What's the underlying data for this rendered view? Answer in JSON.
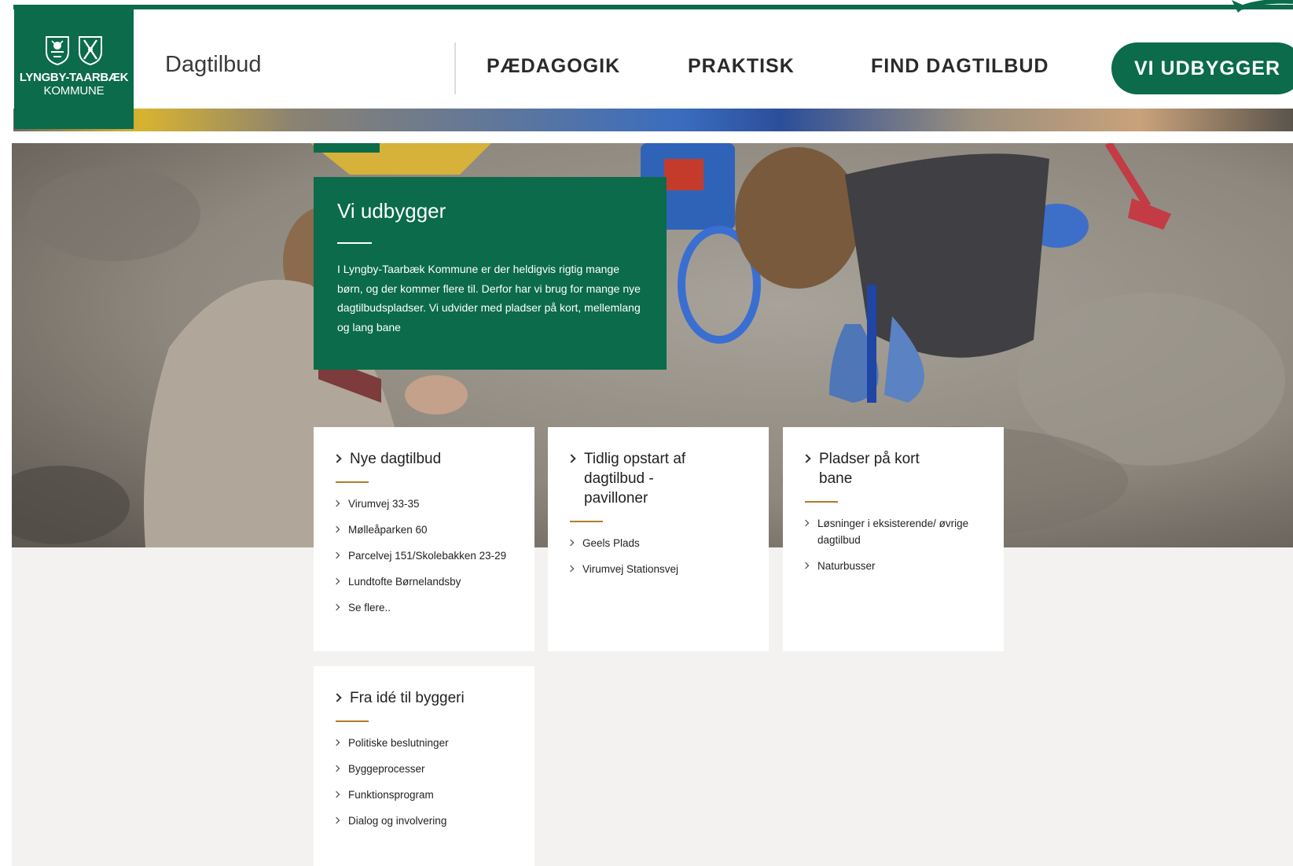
{
  "brand": {
    "logo_line1": "LYNGBY-TAARBÆK",
    "logo_line2": "KOMMUNE",
    "site_title": "Dagtilbud"
  },
  "nav": {
    "items": [
      "PÆDAGOGIK",
      "PRAKTISK",
      "FIND DAGTILBUD"
    ],
    "cta": "VI UDBYGGER"
  },
  "hero": {
    "title": "Vi udbygger",
    "text": "I Lyngby-Taarbæk Kommune er der heldigvis rigtig mange børn, og der kommer flere til. Derfor har vi brug for mange nye dagtilbudspladser. Vi udvider med pladser på kort, mellemlang og lang bane"
  },
  "cards": [
    {
      "title": "Nye dagtilbud",
      "links": [
        "Virumvej 33-35",
        "Mølleåparken 60",
        "Parcelvej 151/Skolebakken 23-29",
        "Lundtofte Børnelandsby",
        "Se flere.."
      ]
    },
    {
      "title": "Tidlig opstart af dagtilbud - pavilloner",
      "links": [
        "Geels Plads",
        "Virumvej Stationsvej"
      ]
    },
    {
      "title": "Pladser på kort bane",
      "links": [
        "Løsninger i eksisterende/ øvrige dagtilbud",
        "Naturbusser"
      ]
    },
    {
      "title": "Fra idé til byggeri",
      "links": [
        "Politiske beslutninger",
        "Byggeprocesser",
        "Funktionsprogram",
        "Dialog og involvering"
      ]
    }
  ],
  "colors": {
    "brand_green": "#0b6b4a",
    "accent_gold": "#b27a2a",
    "page_background": "#f3f2f1"
  },
  "icons": {
    "link_marker": "chevron-right-icon",
    "logo_marks": "coat-of-arms-icon"
  }
}
